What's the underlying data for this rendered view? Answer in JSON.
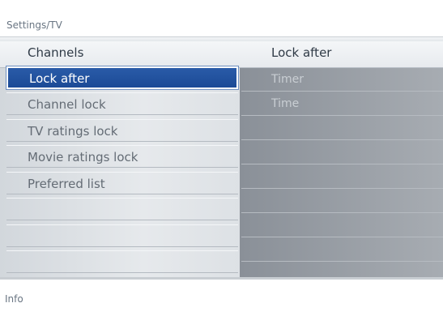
{
  "breadcrumb": "Settings/TV",
  "left_column": {
    "header": "Channels",
    "items": [
      {
        "label": "Lock after",
        "selected": true
      },
      {
        "label": "Channel lock",
        "selected": false
      },
      {
        "label": "TV ratings lock",
        "selected": false
      },
      {
        "label": "Movie ratings lock",
        "selected": false
      },
      {
        "label": "Preferred list",
        "selected": false
      },
      {
        "label": "",
        "selected": false
      },
      {
        "label": "",
        "selected": false
      },
      {
        "label": "",
        "selected": false
      }
    ]
  },
  "right_column": {
    "header": "Lock after",
    "items": [
      {
        "label": "Timer"
      },
      {
        "label": "Time"
      },
      {
        "label": ""
      },
      {
        "label": ""
      },
      {
        "label": ""
      },
      {
        "label": ""
      },
      {
        "label": ""
      },
      {
        "label": ""
      }
    ]
  },
  "info": "Info",
  "colors": {
    "selection": "#1f4f9c",
    "panel_right": "#9aa0a7"
  }
}
